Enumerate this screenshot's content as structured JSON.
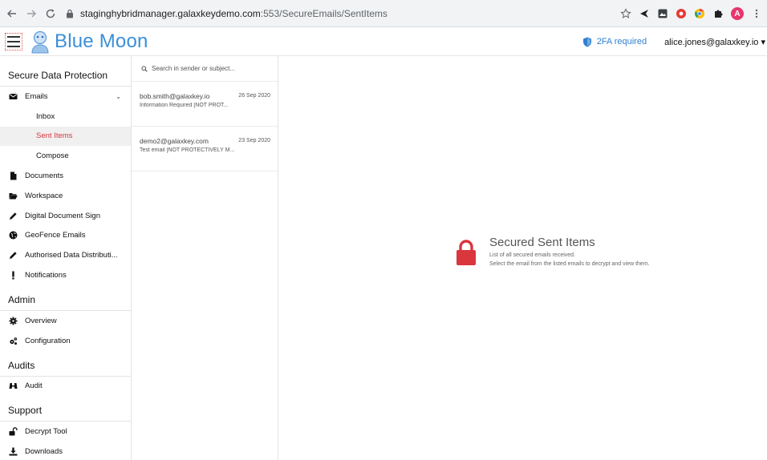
{
  "browser": {
    "url_host": "staginghybridmanager.galaxkeydemo.com",
    "url_path": ":553/SecureEmails/SentItems",
    "profile_initial": "A"
  },
  "header": {
    "brand": "Blue Moon",
    "twofa_label": "2FA required",
    "user_label": "alice.jones@galaxkey.io ▾"
  },
  "sidebar": {
    "sections": [
      {
        "title": "Secure Data Protection",
        "items": [
          {
            "label": "Emails",
            "icon": "envelope-icon",
            "expanded": true
          },
          {
            "label": "Inbox",
            "sub": true
          },
          {
            "label": "Sent Items",
            "sub": true,
            "active": true
          },
          {
            "label": "Compose",
            "sub": true
          },
          {
            "label": "Documents",
            "icon": "document-icon"
          },
          {
            "label": "Workspace",
            "icon": "folder-open-icon"
          },
          {
            "label": "Digital Document Sign",
            "icon": "pencil-icon"
          },
          {
            "label": "GeoFence Emails",
            "icon": "globe-icon"
          },
          {
            "label": "Authorised Data Distributi...",
            "icon": "pencil-icon"
          },
          {
            "label": "Notifications",
            "icon": "exclamation-icon"
          }
        ]
      },
      {
        "title": "Admin",
        "items": [
          {
            "label": "Overview",
            "icon": "gear-icon"
          },
          {
            "label": "Configuration",
            "icon": "gears-icon"
          }
        ]
      },
      {
        "title": "Audits",
        "items": [
          {
            "label": "Audit",
            "icon": "binoculars-icon"
          }
        ]
      },
      {
        "title": "Support",
        "items": [
          {
            "label": "Decrypt Tool",
            "icon": "unlock-icon"
          },
          {
            "label": "Downloads",
            "icon": "download-icon"
          }
        ]
      }
    ]
  },
  "search": {
    "placeholder": "Search in sender or subject..."
  },
  "emails": [
    {
      "from": "bob.smith@galaxkey.io",
      "date": "26 Sep 2020",
      "subject": "Information Required [NOT PROT..."
    },
    {
      "from": "demo2@galaxkey.com",
      "date": "23 Sep 2020",
      "subject": "Test email [NOT PROTECTIVELY M..."
    }
  ],
  "empty_state": {
    "title": "Secured Sent Items",
    "line1": "List of all secured emails received.",
    "line2": "Select the email from the listed emails to decrypt and view them."
  },
  "colors": {
    "brand": "#3a8fd9",
    "active": "#d9363e",
    "lock": "#d9363e"
  }
}
